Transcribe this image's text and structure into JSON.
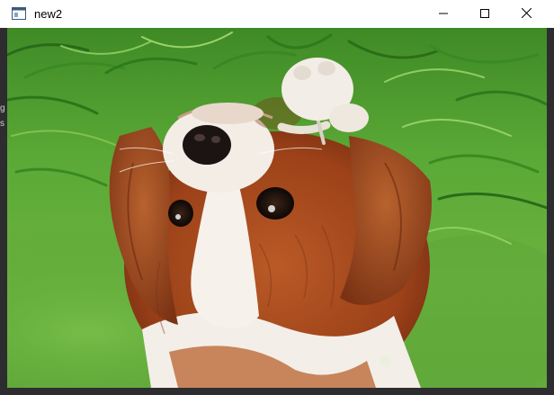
{
  "window": {
    "title": "new2",
    "app_icon": "window-app-icon",
    "controls": {
      "minimize_icon": "minimize-icon",
      "maximize_icon": "maximize-icon",
      "close_icon": "close-icon"
    }
  },
  "image": {
    "subject": "dog-photo",
    "orientation": "flipped-vertical"
  },
  "background_window": {
    "fragments": [
      "g",
      "s"
    ]
  },
  "colors": {
    "titlebar": "#ffffff",
    "grass_light": "#7cc24a",
    "grass_dark": "#2f6e1c",
    "fur_brown": "#a64a1e",
    "fur_white": "#f3eee8"
  }
}
